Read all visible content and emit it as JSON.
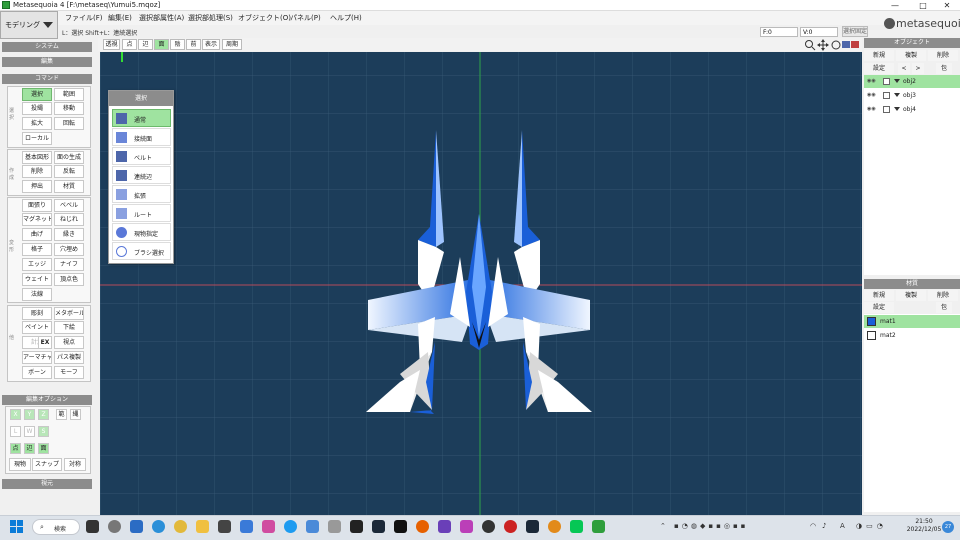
{
  "window": {
    "title": "Metasequoia 4 [F:\\metaseq\\Yumui5.mqoz]",
    "minimize": "—",
    "maximize": "□",
    "close": "✕"
  },
  "mode_select": {
    "value": "モデリング"
  },
  "menu": [
    "ファイル(F)",
    "編集(E)",
    "選択部属性(A)",
    "選択部処理(S)",
    "オブジェクト(O)",
    "パネル(P)",
    "ヘルプ(H)"
  ],
  "hint": "L：選択  Shift+L：連続選択",
  "fields": {
    "f": "F:0",
    "v": "V:0",
    "origin_button": "選択固定"
  },
  "logo": {
    "text": "metasequoia",
    "version": "4"
  },
  "left_panel": {
    "system": "システム",
    "edit": "編集",
    "command": "コマンド",
    "group_select": "選択",
    "select_buttons": [
      "選択",
      "範囲",
      "投縄",
      "移動",
      "拡大",
      "回転",
      "ローカル"
    ],
    "group_create": "作成",
    "create_buttons": [
      "基本図形",
      "面の生成",
      "削除",
      "反転",
      "押出",
      "材質"
    ],
    "group_transform": "変形",
    "transform_buttons": [
      "面張り",
      "ベベル",
      "マグネット",
      "ねじれ",
      "曲げ",
      "縁き",
      "格子",
      "穴埋め",
      "エッジ",
      "ナイフ",
      "ウェイト",
      "頂点色",
      "法線"
    ],
    "group_misc": "他",
    "misc_buttons": [
      "彫刻",
      "メタボール",
      "ペイント",
      "下絵",
      "計測",
      "EX",
      "視点",
      "アーマチャー",
      "パス複製",
      "ボーン",
      "モーフ"
    ],
    "edit_options": "編集オプション",
    "axis_buttons": [
      "X",
      "Y",
      "Z",
      "範",
      "縄",
      "L",
      "W",
      "S",
      "点",
      "辺",
      "面"
    ],
    "opt_buttons": [
      "現物",
      "スナップ",
      "対称"
    ],
    "preview": "視元"
  },
  "view_toolbar": [
    "透視",
    "点",
    "辺",
    "面",
    "陰",
    "前",
    "表示",
    "周期"
  ],
  "select_popup": {
    "title": "選択",
    "items": [
      "通常",
      "接続面",
      "ベルト",
      "連続辺",
      "拡張",
      "ルート",
      "現物指定",
      "ブラシ選択"
    ]
  },
  "objects_panel": {
    "title": "オブジェクト",
    "buttons": [
      "新規",
      "複製",
      "削除",
      "設定",
      "<",
      ">",
      "包"
    ],
    "items": [
      "obj2",
      "obj3",
      "obj4"
    ],
    "selected": "obj2"
  },
  "materials_panel": {
    "title": "材質",
    "buttons": [
      "新規",
      "複製",
      "削除",
      "設定",
      "包"
    ],
    "items": [
      {
        "name": "mat1",
        "color": "#1a5fd8"
      },
      {
        "name": "mat2",
        "color": "#ffffff"
      }
    ],
    "selected": "mat1"
  },
  "taskbar": {
    "search": "検索",
    "clock_time": "21:50",
    "clock_date": "2022/12/05",
    "notifications": "27",
    "ime": "A"
  },
  "colors": {
    "viewport_bg": "#1c3d5a",
    "selected_green": "#9fe3a0",
    "panel_header": "#8c8c8c",
    "model_blue": "#1a5fd8"
  }
}
